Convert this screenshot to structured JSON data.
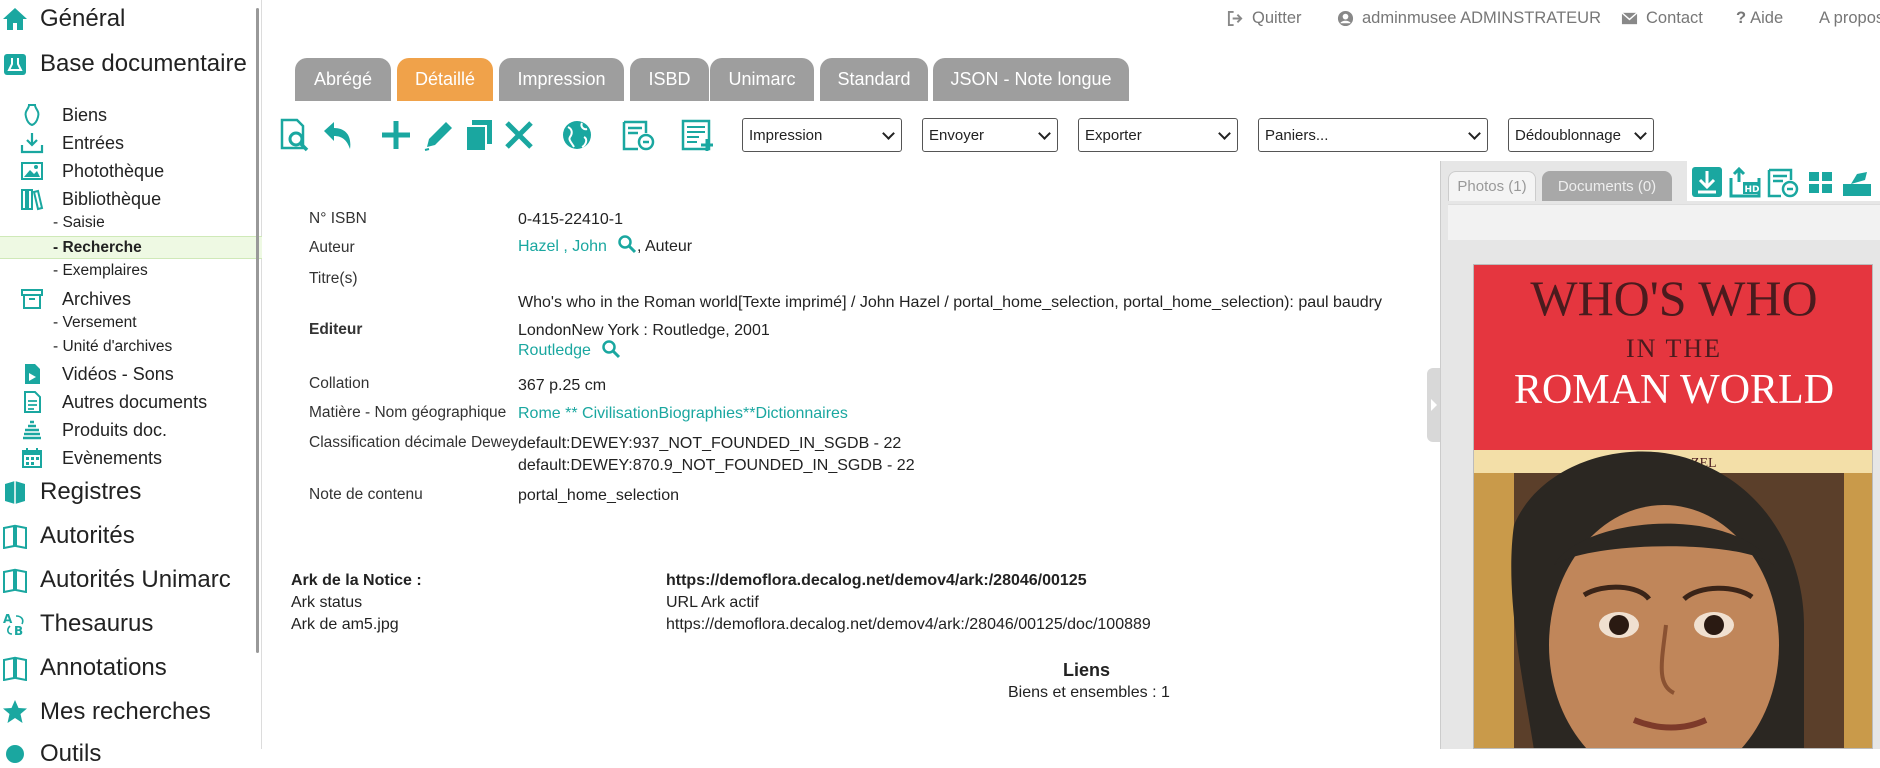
{
  "sidebar": {
    "general": "Général",
    "base_doc": "Base documentaire",
    "items": [
      {
        "label": "Biens"
      },
      {
        "label": "Entrées"
      },
      {
        "label": "Photothèque"
      },
      {
        "label": "Bibliothèque"
      },
      {
        "label": "Archives"
      },
      {
        "label": "Vidéos - Sons"
      },
      {
        "label": "Autres documents"
      },
      {
        "label": "Produits doc."
      },
      {
        "label": "Evènements"
      }
    ],
    "biblio_subs": [
      "- Saisie",
      "- Recherche",
      "- Exemplaires"
    ],
    "archives_subs": [
      "- Versement",
      "- Unité d'archives"
    ],
    "sections": [
      "Registres",
      "Autorités",
      "Autorités Unimarc",
      "Thesaurus",
      "Annotations",
      "Mes recherches",
      "Outils"
    ]
  },
  "topbar": {
    "quit": "Quitter",
    "user": "adminmusee ADMINSTRATEUR",
    "contact": "Contact",
    "help": "Aide",
    "about": "A propos"
  },
  "tabs": [
    "Abrégé",
    "Détaillé",
    "Impression",
    "ISBD",
    "Unimarc",
    "Standard",
    "JSON - Note longue"
  ],
  "active_tab": "Détaillé",
  "toolbar": {
    "icons": [
      "preview-icon",
      "undo-icon",
      "add-icon",
      "edit-icon",
      "copy-icon",
      "delete-icon",
      "globe-icon",
      "view-list-icon",
      "form-add-icon"
    ],
    "selects": [
      "Impression",
      "Envoyer",
      "Exporter",
      "Paniers...",
      "Dédoublonnage"
    ]
  },
  "record": {
    "isbn_label": "N° ISBN",
    "isbn": "0-415-22410-1",
    "author_label": "Auteur",
    "author_link": "Hazel , John",
    "author_role": ",   Auteur",
    "title_label": "Titre(s)",
    "title": "Who's who in the Roman world[Texte imprimé] / John Hazel / portal_home_selection, portal_home_selection): paul baudry",
    "publisher_label": "Editeur",
    "publisher": "LondonNew York : Routledge, 2001",
    "publisher_link": "Routledge",
    "collation_label": "Collation",
    "collation": "367 p.25 cm",
    "subject_label": "Matière - Nom géographique",
    "subject": "Rome ** CivilisationBiographies**Dictionnaires",
    "dewey_label": "Classification décimale Dewey",
    "dewey": [
      "default:DEWEY:937_NOT_FOUNDED_IN_SGDB - 22",
      "default:DEWEY:870.9_NOT_FOUNDED_IN_SGDB - 22"
    ],
    "note_label": "Note de contenu",
    "note": "portal_home_selection"
  },
  "ark": {
    "notice_label": "Ark de la Notice :",
    "notice_url": "https://demoflora.decalog.net/demov4/ark:/28046/00125",
    "status_label": "Ark status",
    "status": "URL Ark actif",
    "image_label": "Ark de am5.jpg",
    "image_url": "https://demoflora.decalog.net/demov4/ark:/28046/00125/doc/100889"
  },
  "links": {
    "title": "Liens",
    "item": "Biens et ensembles : 1"
  },
  "panel": {
    "photos_tab": "Photos (1)",
    "documents_tab": "Documents (0)",
    "cover": {
      "line1": "WHO'S WHO",
      "line2": "IN THE",
      "line3": "ROMAN WORLD",
      "author": "JOHN HAZEL"
    }
  },
  "colors": {
    "accent": "#1aa7a0",
    "active_tab": "#f0a24a",
    "tab": "#9e9e9e",
    "cover_red": "#e5363f"
  }
}
